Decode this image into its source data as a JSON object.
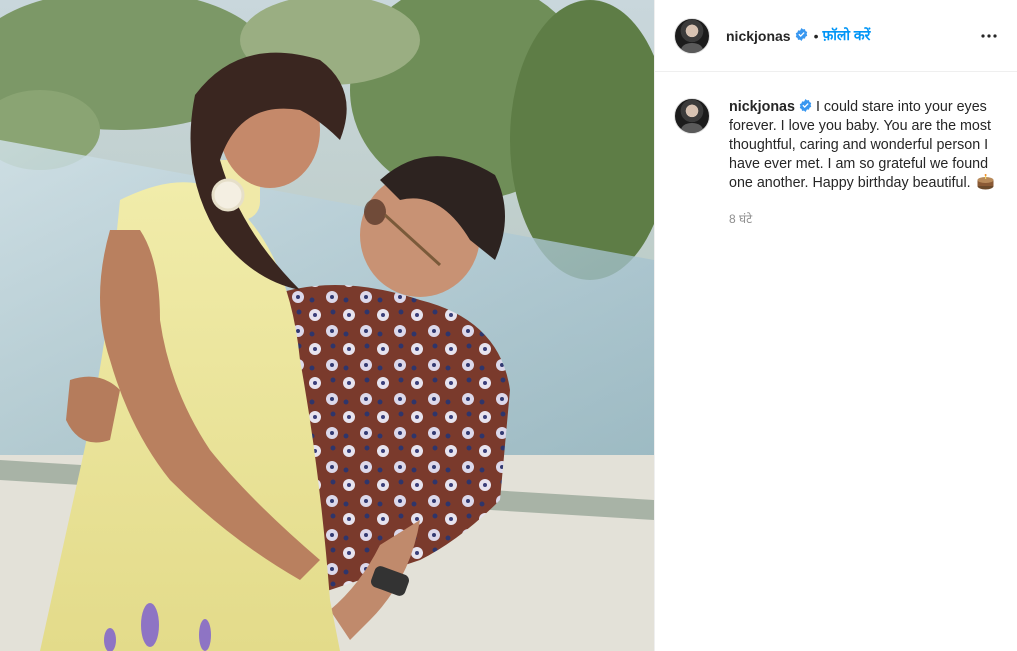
{
  "post": {
    "author": {
      "username": "nickjonas",
      "verified_icon": "verified-badge-icon",
      "follow_label": "फ़ॉलो करें",
      "separator": "•"
    },
    "more_icon": "more-options-icon",
    "caption": {
      "username": "nickjonas",
      "text": "I could stare into your eyes forever. I love you baby. You are the most thoughtful, caring and wonderful person I have ever met. I am so grateful we found one another. Happy birthday beautiful.",
      "emoji_icon": "birthday-cake-icon",
      "timestamp": "8 घंटे"
    },
    "colors": {
      "link_blue": "#0095f6",
      "verified_blue": "#3897f0",
      "text": "#262626",
      "muted": "#8e8e8e"
    }
  }
}
